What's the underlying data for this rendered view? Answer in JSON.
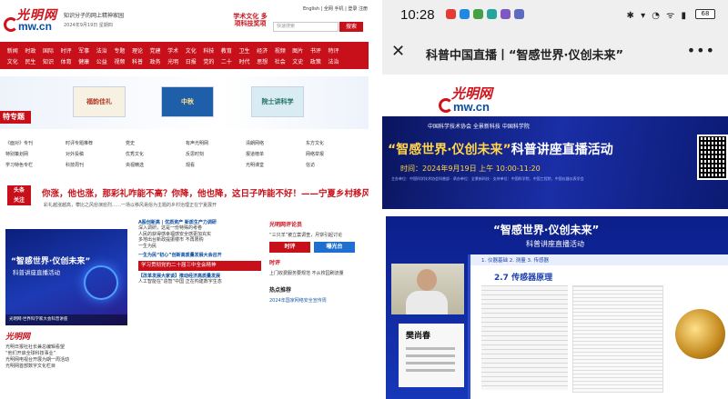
{
  "left": {
    "header": {
      "tagline": "知识分子的网上精神家园",
      "date": "2024年9月19日  星期四",
      "badge": "学术文化 多项科技奖项",
      "langs": "English | 全网  手机 | 登录 注册",
      "search_placeholder": "快速搜索",
      "search_button": "搜索"
    },
    "nav": {
      "row1": [
        "新闻",
        "时政",
        "国际",
        "时评",
        "军事",
        "法治",
        "专题",
        "理论",
        "党建",
        "学术",
        "文化",
        "科技",
        "教育",
        "卫生",
        "经济",
        "视频",
        "图片",
        "书评",
        "特评"
      ],
      "row2": [
        "文化",
        "民生",
        "知识",
        "体育",
        "健康",
        "公益",
        "视频",
        "科普",
        "政务",
        "光明",
        "日报",
        "党的",
        "二十",
        "时代",
        "思想",
        "社会",
        "文史",
        "政策",
        "法治"
      ]
    },
    "zone_label": "特专题",
    "banners": [
      "福韵佳礼",
      "中秋",
      "院士讲科学"
    ],
    "links": [
      "《面对》专刊",
      "时评专题推荐",
      "党史",
      "有声光明网",
      "清朗网络",
      "东方文化",
      "特别策划网",
      "对外投稿",
      "优秀文化",
      "反思时刻",
      "报道榜单",
      "网络举报",
      "学习特色专栏",
      "科技周刊",
      "央视精选",
      "观看",
      "光明课堂",
      "信访"
    ],
    "headline": {
      "badge_line1": "头条",
      "badge_line2": "关注",
      "title": "你涨，他也涨，那彩礼咋能不高？你降，他也降，这日子咋能不好！——宁夏乡村移风易俗纪实",
      "sub": "彩礼越涨越高，攀比之风愈演愈烈……一场以移风易俗为主题的乡村治理正在宁夏展开"
    },
    "card": {
      "title": "“智感世界·仪创未来”",
      "subtitle": "科普讲座直播活动",
      "caption": "光明网·世界科学家大会科普讲座"
    },
    "middle": {
      "h1": "A股创新高 | 优质资产 新质生产力调研",
      "lines": [
        "深入调研，这是一份特殊的考卷",
        "人民的获得感幸福感安全感更加充实",
        "多地出台新政提振楼市 不再限购",
        "一生为民"
      ],
      "h2": "一生为民“初心”创新高质量发展大会召开",
      "red_bar": "学习贯彻党的二十届三中全会精神",
      "h3": "【改革发展大家谈】推动经济高质量发展",
      "more": "人工智能在“造智”中国 正在构建数字生态"
    },
    "right": {
      "title": "光明网评论员",
      "line1": "“三只羊”被立案调查，月饼引起讨论",
      "btn1": "时评",
      "btn2": "曝光台",
      "title2": "时评",
      "line2": "上门收费服务要规范 不从校园刷流量",
      "title3": "热点推荐",
      "line3": "2024年国家网络安全宣传周"
    },
    "bottom": {
      "logo": "光明网",
      "lines": [
        "光明日报社社长兼总编辑看望",
        "“他们开启全球科技事业”",
        "光明网电视台开展为期一周活动",
        "光明网首部数字文化栏目"
      ]
    }
  },
  "phone": {
    "status": {
      "time": "10:28",
      "battery": "68"
    },
    "title": "科普中国直播丨“智感世界·仪创未来”",
    "banner": {
      "orgs": "中国科学技术协会  全景新科技  中国科学院",
      "headline_highlight": "“智感世界·仪创未来”",
      "headline_rest": "科普讲座直播活动",
      "when": "时间：2024年9月19日 上午 10:00-11:20",
      "fine": "主办单位：中国科学技术协会科普部 · 承办单位：全景新科技 · 支持单位：中国科学院、中国工程院、中国仪器仪表学会"
    }
  },
  "lecture": {
    "title_highlight": "“智感世界·仪创未来”",
    "subtitle": "科普讲座直播活动",
    "slide_tabs": "1. 仪器基础   2. 测量   3. 传感器",
    "slide_title": "2.7 传感器原理",
    "speaker": "樊尚春"
  }
}
